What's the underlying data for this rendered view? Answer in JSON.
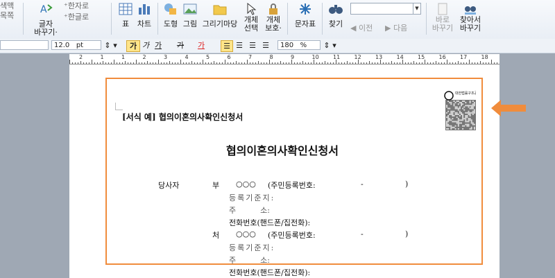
{
  "ribbon": {
    "left_partial": [
      "색맥",
      "목쪽"
    ],
    "char_change": "글자\n바꾸기·",
    "hanja": "한자로",
    "hangul": "한글로",
    "table": "표",
    "chart": "차트",
    "shape": "도형",
    "picture": "그림",
    "draw_pad": "그리기마당",
    "obj_select": "개체\n선택",
    "obj_protect": "개체\n보호·",
    "charmap": "문자표",
    "find": "찾기",
    "find_value": "",
    "prev": "이전",
    "next": "다음",
    "goto": "바로\n바꾸기",
    "find_replace": "찾아서\n바꾸기"
  },
  "format_bar": {
    "font_size": "12.0",
    "unit": "pt",
    "bold": "가",
    "italic": "가",
    "underline": "가",
    "strike": "가",
    "color": "가",
    "zoom": "180",
    "zoom_unit": "%"
  },
  "ruler": [
    "2",
    "1",
    "1",
    "2",
    "3",
    "4",
    "5",
    "6",
    "7",
    "8",
    "9",
    "10",
    "11",
    "12",
    "13",
    "14",
    "15",
    "16",
    "17",
    "18"
  ],
  "document": {
    "form_label": "[서식 예] 협의이혼의사확인신청서",
    "title": "협의이혼의사확인신청서",
    "party": "당사자",
    "husband": "부",
    "wife": "처",
    "name_mark": "○○○",
    "reg_no": "(주민등록번호:",
    "dash": "-",
    "close": ")",
    "reg_base": "등록기준지:",
    "address": "주          소:",
    "phone": "전화번호(핸드폰/집전화):"
  },
  "qr_label": "대한법률구조공단 www.klac.or.kr",
  "colors": {
    "frame": "#f08c3c",
    "arrow": "#f08c3c"
  }
}
